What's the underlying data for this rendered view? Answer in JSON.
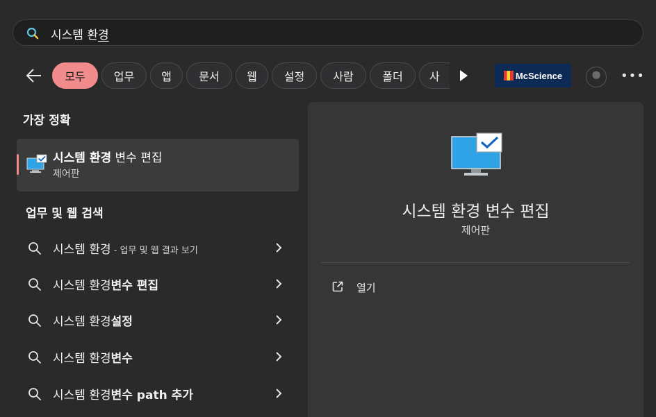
{
  "search": {
    "query_prefix": "시스템 환",
    "query_composing": "경"
  },
  "filters": {
    "chips": [
      "모두",
      "업무",
      "앱",
      "문서",
      "웹",
      "설정",
      "사람",
      "폴더",
      "사"
    ],
    "active_index": 0,
    "brand_logo_text": "McScience"
  },
  "left": {
    "best_match_header": "가장 정확",
    "best_match": {
      "title_bold": "시스템 환경",
      "title_rest": " 변수 편집",
      "subtitle": "제어판"
    },
    "web_header": "업무 및 웹 검색",
    "web_results": [
      {
        "normal": "시스템 환경",
        "bold": "",
        "suffix": " - 업무 및 웹 결과 보기"
      },
      {
        "normal": "시스템 환경",
        "bold": "변수 편집",
        "suffix": ""
      },
      {
        "normal": "시스템 환경",
        "bold": "설정",
        "suffix": ""
      },
      {
        "normal": "시스템 환경",
        "bold": "변수",
        "suffix": ""
      },
      {
        "normal": "시스템 환경",
        "bold": "변수 path 추가",
        "suffix": ""
      }
    ]
  },
  "right": {
    "title": "시스템 환경 변수 편집",
    "subtitle": "제어판",
    "actions": [
      "열기"
    ]
  },
  "colors": {
    "accent": "#f28b8c",
    "background": "#2a2a2b",
    "panel": "#363637"
  }
}
